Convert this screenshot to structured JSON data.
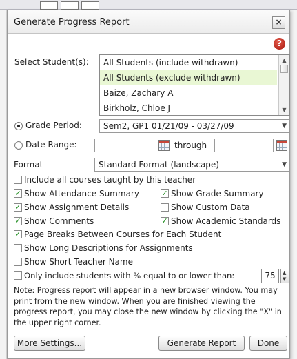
{
  "dialog": {
    "title": "Generate Progress Report",
    "close_glyph": "×",
    "help_icon": "?"
  },
  "students": {
    "label": "Select Student(s):",
    "options": [
      "All Students (include withdrawn)",
      "All Students (exclude withdrawn)",
      "Baize, Zachary A",
      "Birkholz, Chloe J"
    ]
  },
  "grade_period": {
    "label": "Grade Period:",
    "value": "Sem2, GP1  01/21/09 - 03/27/09"
  },
  "date_range": {
    "label": "Date Range:",
    "from": "",
    "through_label": "through",
    "to": ""
  },
  "format": {
    "label": "Format",
    "value": "Standard Format (landscape)"
  },
  "options": {
    "include_all_courses": {
      "label": "Include all courses taught by this teacher",
      "checked": false
    },
    "show_attendance_summary": {
      "label": "Show Attendance Summary",
      "checked": true
    },
    "show_grade_summary": {
      "label": "Show Grade Summary",
      "checked": true
    },
    "show_assignment_details": {
      "label": "Show Assignment Details",
      "checked": true
    },
    "show_custom_data": {
      "label": "Show Custom Data",
      "checked": false
    },
    "show_comments": {
      "label": "Show Comments",
      "checked": true
    },
    "show_academic_standards": {
      "label": "Show Academic Standards",
      "checked": true
    },
    "page_breaks": {
      "label": "Page Breaks Between Courses for Each Student",
      "checked": true
    },
    "show_long_descriptions": {
      "label": "Show Long Descriptions for Assignments",
      "checked": false
    },
    "show_short_teacher_name": {
      "label": "Show Short Teacher Name",
      "checked": false
    },
    "only_include": {
      "label": "Only include students with % equal to or lower than:",
      "checked": false,
      "value": "75"
    }
  },
  "note": "Note: Progress report will appear in a new browser window. You may print from the new window. When you are finished viewing the progress report, you may close the new window by clicking the \"X\" in the upper right corner.",
  "buttons": {
    "more_settings": "More Settings...",
    "generate": "Generate Report",
    "done": "Done"
  }
}
